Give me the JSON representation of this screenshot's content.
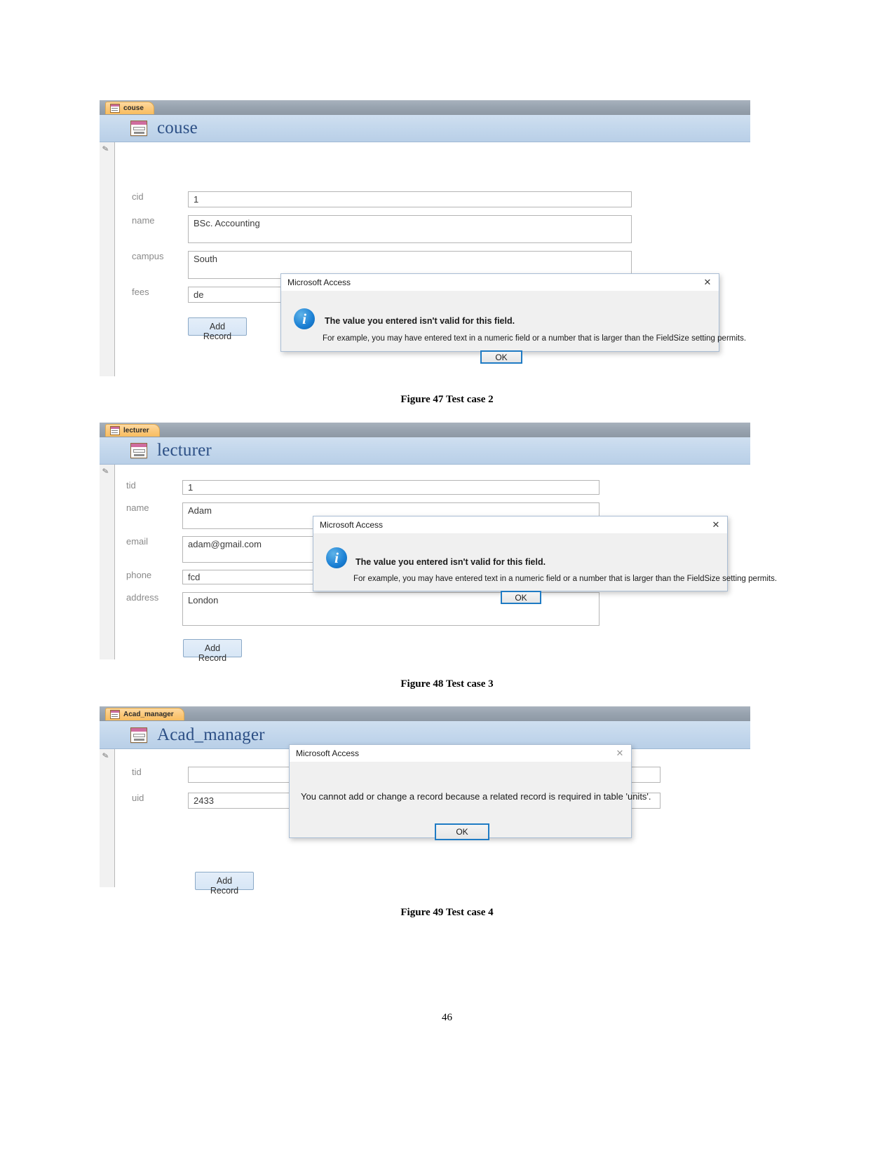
{
  "page": {
    "number": "46"
  },
  "figures": [
    {
      "caption": "Figure 47 Test case 2",
      "form": {
        "tab_label": "couse",
        "title": "couse",
        "fields": [
          {
            "label": "cid",
            "value": "1"
          },
          {
            "label": "name",
            "value": "BSc. Accounting"
          },
          {
            "label": "campus",
            "value": "South"
          },
          {
            "label": "fees",
            "value": "de"
          }
        ],
        "add_record_label": "Add Record"
      },
      "dialog": {
        "title": "Microsoft Access",
        "close_icon": "✕",
        "icon": "information-icon",
        "icon_glyph": "i",
        "heading": "The value you entered isn't valid for this field.",
        "detail": "For example, you may have entered text in a numeric field or a number that is larger than the FieldSize setting permits.",
        "ok_label": "OK"
      }
    },
    {
      "caption": "Figure 48 Test case 3",
      "form": {
        "tab_label": "lecturer",
        "title": "lecturer",
        "fields": [
          {
            "label": "tid",
            "value": "1"
          },
          {
            "label": "name",
            "value": "Adam"
          },
          {
            "label": "email",
            "value": "adam@gmail.com"
          },
          {
            "label": "phone",
            "value": "fcd"
          },
          {
            "label": "address",
            "value": "London"
          }
        ],
        "add_record_label": "Add Record"
      },
      "dialog": {
        "title": "Microsoft Access",
        "close_icon": "✕",
        "icon": "information-icon",
        "icon_glyph": "i",
        "heading": "The value you entered isn't valid for this field.",
        "detail": "For example, you may have entered text in a numeric field or a number that is larger than the FieldSize setting permits.",
        "ok_label": "OK"
      }
    },
    {
      "caption": "Figure 49 Test case 4",
      "form": {
        "tab_label": "Acad_manager",
        "title": "Acad_manager",
        "fields": [
          {
            "label": "tid",
            "value": ""
          },
          {
            "label": "uid",
            "value": "2433"
          }
        ],
        "add_record_label": "Add Record"
      },
      "dialog": {
        "title": "Microsoft Access",
        "close_icon": "✕",
        "icon": "none",
        "heading": "",
        "detail": "You cannot add or change a record because a related record is required in table 'units'.",
        "ok_label": "OK"
      }
    }
  ],
  "colors": {
    "tab_orange": "#f8bd60",
    "header_blue": "#c3d7ec",
    "title_text": "#2c4f85",
    "info_blue": "#1a7fd4",
    "ok_border": "#1f7bc4"
  }
}
